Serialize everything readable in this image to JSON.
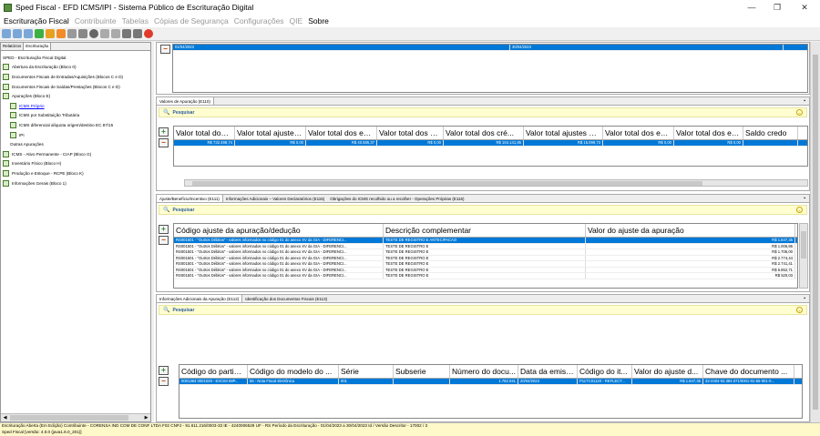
{
  "window": {
    "title": "Sped Fiscal - EFD ICMS/IPI - Sistema Público de Escrituração Digital",
    "minimize": "—",
    "maximize": "❐",
    "close": "✕"
  },
  "menu": [
    {
      "label": "Escrituração Fiscal",
      "disabled": false
    },
    {
      "label": "Contribuinte",
      "disabled": true
    },
    {
      "label": "Tabelas",
      "disabled": true
    },
    {
      "label": "Cópias de Segurança",
      "disabled": true
    },
    {
      "label": "Configurações",
      "disabled": true
    },
    {
      "label": "QIE",
      "disabled": true
    },
    {
      "label": "Sobre",
      "disabled": false
    }
  ],
  "left_tabs": [
    "Relatórios",
    "Escrituração"
  ],
  "tree": [
    {
      "label": "SPED - Escrituração Fiscal Digital",
      "depth": 0,
      "icon": false
    },
    {
      "label": "Abertura da Escrituração (Bloco 0)",
      "depth": 0,
      "icon": true
    },
    {
      "label": "Documentos Fiscais de Entradas/Aquisições (Blocos C e D)",
      "depth": 0,
      "icon": true
    },
    {
      "label": "Documentos Fiscais de Saídas/Prestações (Blocos C e D)",
      "depth": 0,
      "icon": true
    },
    {
      "label": "Apurações (Bloco E)",
      "depth": 0,
      "icon": true
    },
    {
      "label": "ICMS Próprio",
      "depth": 1,
      "icon": true,
      "selected": true
    },
    {
      "label": "ICMS por Substituição Tributária",
      "depth": 1,
      "icon": true
    },
    {
      "label": "ICMS diferencial alíquota origem/destino EC 87/15",
      "depth": 1,
      "icon": true
    },
    {
      "label": "IPI",
      "depth": 1,
      "icon": true
    },
    {
      "label": "Outras Apurações",
      "depth": 1,
      "icon": false
    },
    {
      "label": "ICMS - Ativo Permanente - CIAP (Bloco G)",
      "depth": 0,
      "icon": true
    },
    {
      "label": "Inventário Físico (Bloco H)",
      "depth": 0,
      "icon": true
    },
    {
      "label": "Produção e Estoque - RCPE (Bloco K)",
      "depth": 0,
      "icon": true
    },
    {
      "label": "Informações Gerais (Bloco 1)",
      "depth": 0,
      "icon": true
    }
  ],
  "top_row": {
    "start": "01/04/2023",
    "end": "30/04/2023"
  },
  "panel1": {
    "tab": "Valores de Apuração (E110)",
    "search": "Pesquisar",
    "headers": [
      "Valor total dos d...",
      "Valor total ajustes a ...",
      "Valor total dos est...",
      "Valor total dos est...",
      "Valor total dos cré...",
      "Valor total ajustes a c...",
      "Valor total dos est...",
      "Valor total dos est...",
      "Saldo credo"
    ],
    "row": [
      "R$ 732.498,74",
      "R$ 0,00",
      "R$ 40.585,37",
      "R$ 0,00",
      "R$ 164.141,85",
      "R$ 15.099,73",
      "R$ 0,00",
      "R$ 0,00",
      ""
    ]
  },
  "panel2": {
    "tabs": [
      "Ajuste/Benefício/Incentivo (E111)",
      "Informações Adicionais – Valores Declaratórios (E115)",
      "Obrigações do ICMS recolhido ou a recolher - Operações Próprias (E116)"
    ],
    "search": "Pesquisar",
    "headers": [
      "Código ajuste da apuração/dedução",
      "Descrição complementar",
      "Valor do ajuste da apuração"
    ],
    "rows": [
      [
        "RS001501 - \"Outros Débitos\" - valores informados no código 01 do anexo XV da GIA - DIFERENCI...",
        "TESTE DE REGISTRO E ANTECIPACAO",
        "R$ 1.847,35"
      ],
      [
        "RS001501 - \"Outros Débitos\" - valores informados no código 01 do anexo XV da GIA - DIFERENCI...",
        "TESTE DE REGISTRO E",
        "R$ 1.006,86"
      ],
      [
        "RS001501 - \"Outros Débitos\" - valores informados no código 01 do anexo XV da GIA - DIFERENCI...",
        "TESTE DE REGISTRO E",
        "R$ 1.706,00"
      ],
      [
        "RS001501 - \"Outros Débitos\" - valores informados no código 01 do anexo XV da GIA - DIFERENCI...",
        "TESTE DE REGISTRO E",
        "R$ 2.774,44"
      ],
      [
        "RS001501 - \"Outros Débitos\" - valores informados no código 01 do anexo XV da GIA - DIFERENCI...",
        "TESTE DE REGISTRO E",
        "R$ 2.741,41"
      ],
      [
        "RS001501 - \"Outros Débitos\" - valores informados no código 01 do anexo XV da GIA - DIFERENCI...",
        "TESTE DE REGISTRO E",
        "R$ 6.852,71"
      ],
      [
        "RS001501 - \"Outros Débitos\" - valores informados no código 01 do anexo XV da GIA - DIFERENCI...",
        "TESTE DE REGISTRO E",
        "R$ 520,03"
      ]
    ]
  },
  "panel3": {
    "tabs": [
      "Informações Adicionais da Apuração (E112)",
      "Identificação dos Documentos Fiscais (E113)"
    ],
    "search": "Pesquisar",
    "headers": [
      "Código do partici...",
      "Código do modelo do ...",
      "Série",
      "Subserie",
      "Número do docu...",
      "Data da emiss...",
      "Código do it...",
      "Valor do ajuste d...",
      "Chave do documento ..."
    ],
    "row": [
      "0001384 0001029 - EXCIM IMP...",
      "55 - Nota Fiscal Eletrônica",
      "001",
      "",
      "1.782.041",
      "20/04/2023",
      "P11TC01120 - REFLECT...",
      "R$ 1.847,35",
      "32-2304-02.384.071/0001-01-55-001-0..."
    ]
  },
  "status": {
    "line1": "Escrituração Aberta (Em Edição) Contribuinte - CORENSA IND COM DE CONF LTDA F02 CNPJ - 91.611.216/0003-33 IE - 4240006529 UF - RS Período da Escrituração - 01/04/2023 a 30/04/2023 Id / Versão Descritor - 17002 / 3",
    "line2": "Sped Fiscal [versão: 4.0.0 (java1.8.0_201)]"
  }
}
